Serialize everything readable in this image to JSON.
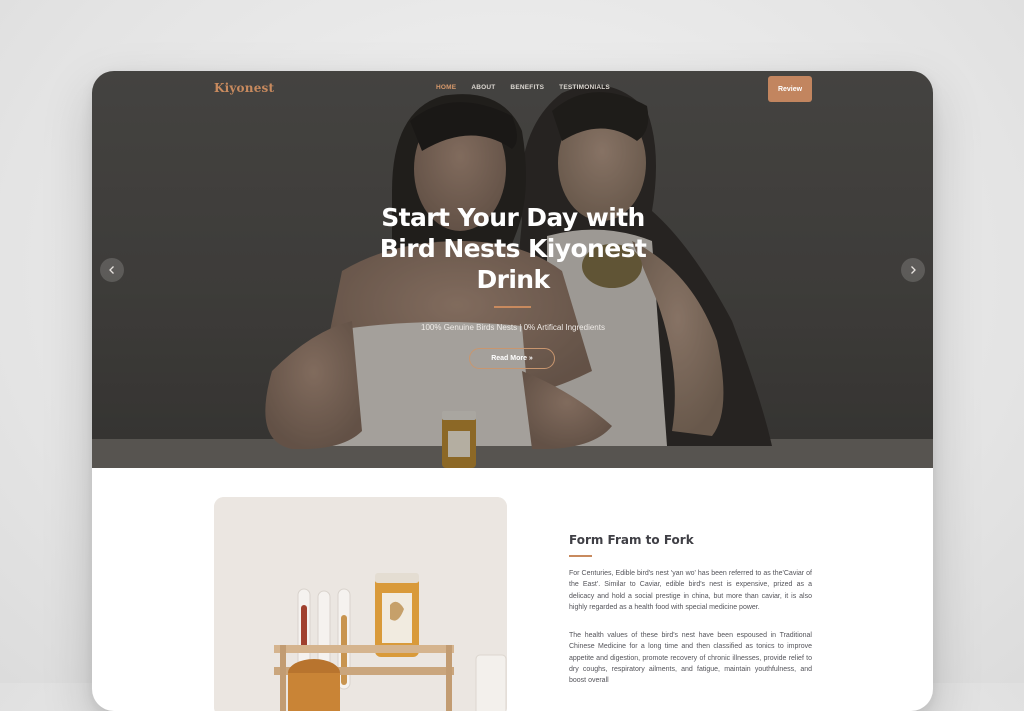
{
  "nav": {
    "logo": "Kiyonest",
    "links": [
      {
        "label": "HOME",
        "active": true
      },
      {
        "label": "ABOUT",
        "active": false
      },
      {
        "label": "BENEFITS",
        "active": false
      },
      {
        "label": "TESTIMONIALS",
        "active": false
      }
    ],
    "review_label": "Review"
  },
  "hero": {
    "title": "Start Your Day with Bird Nests Kiyonest Drink",
    "subtitle": "100% Genuine Birds Nests | 0% Artifical Ingredients",
    "cta_label": "Read More »",
    "prev_icon": "chevron-left-icon",
    "next_icon": "chevron-right-icon"
  },
  "section": {
    "title": "Form Fram to Fork",
    "paragraph1": "For Centuries, Edible bird's nest 'yan wo' has been referred to as the'Caviar of the East'. Similar to Caviar, edible bird's nest is expensive, prized as a delicacy and hold a social prestige in china, but more than caviar, it is also highly regarded as a health food with special medicine power.",
    "paragraph2": "The health values of these bird's nest have been espoused in Traditional Chinese Medicine for a long time and then classified as tonics to improve appetite and digestion, promote recovery of chronic illnesses, provide relief to dry coughs, respiratory ailments, and fatigue, maintain youthfulness, and boost overall"
  },
  "colors": {
    "accent": "#c2855f",
    "logo": "#c88a5e",
    "heading": "#3f3f45"
  }
}
